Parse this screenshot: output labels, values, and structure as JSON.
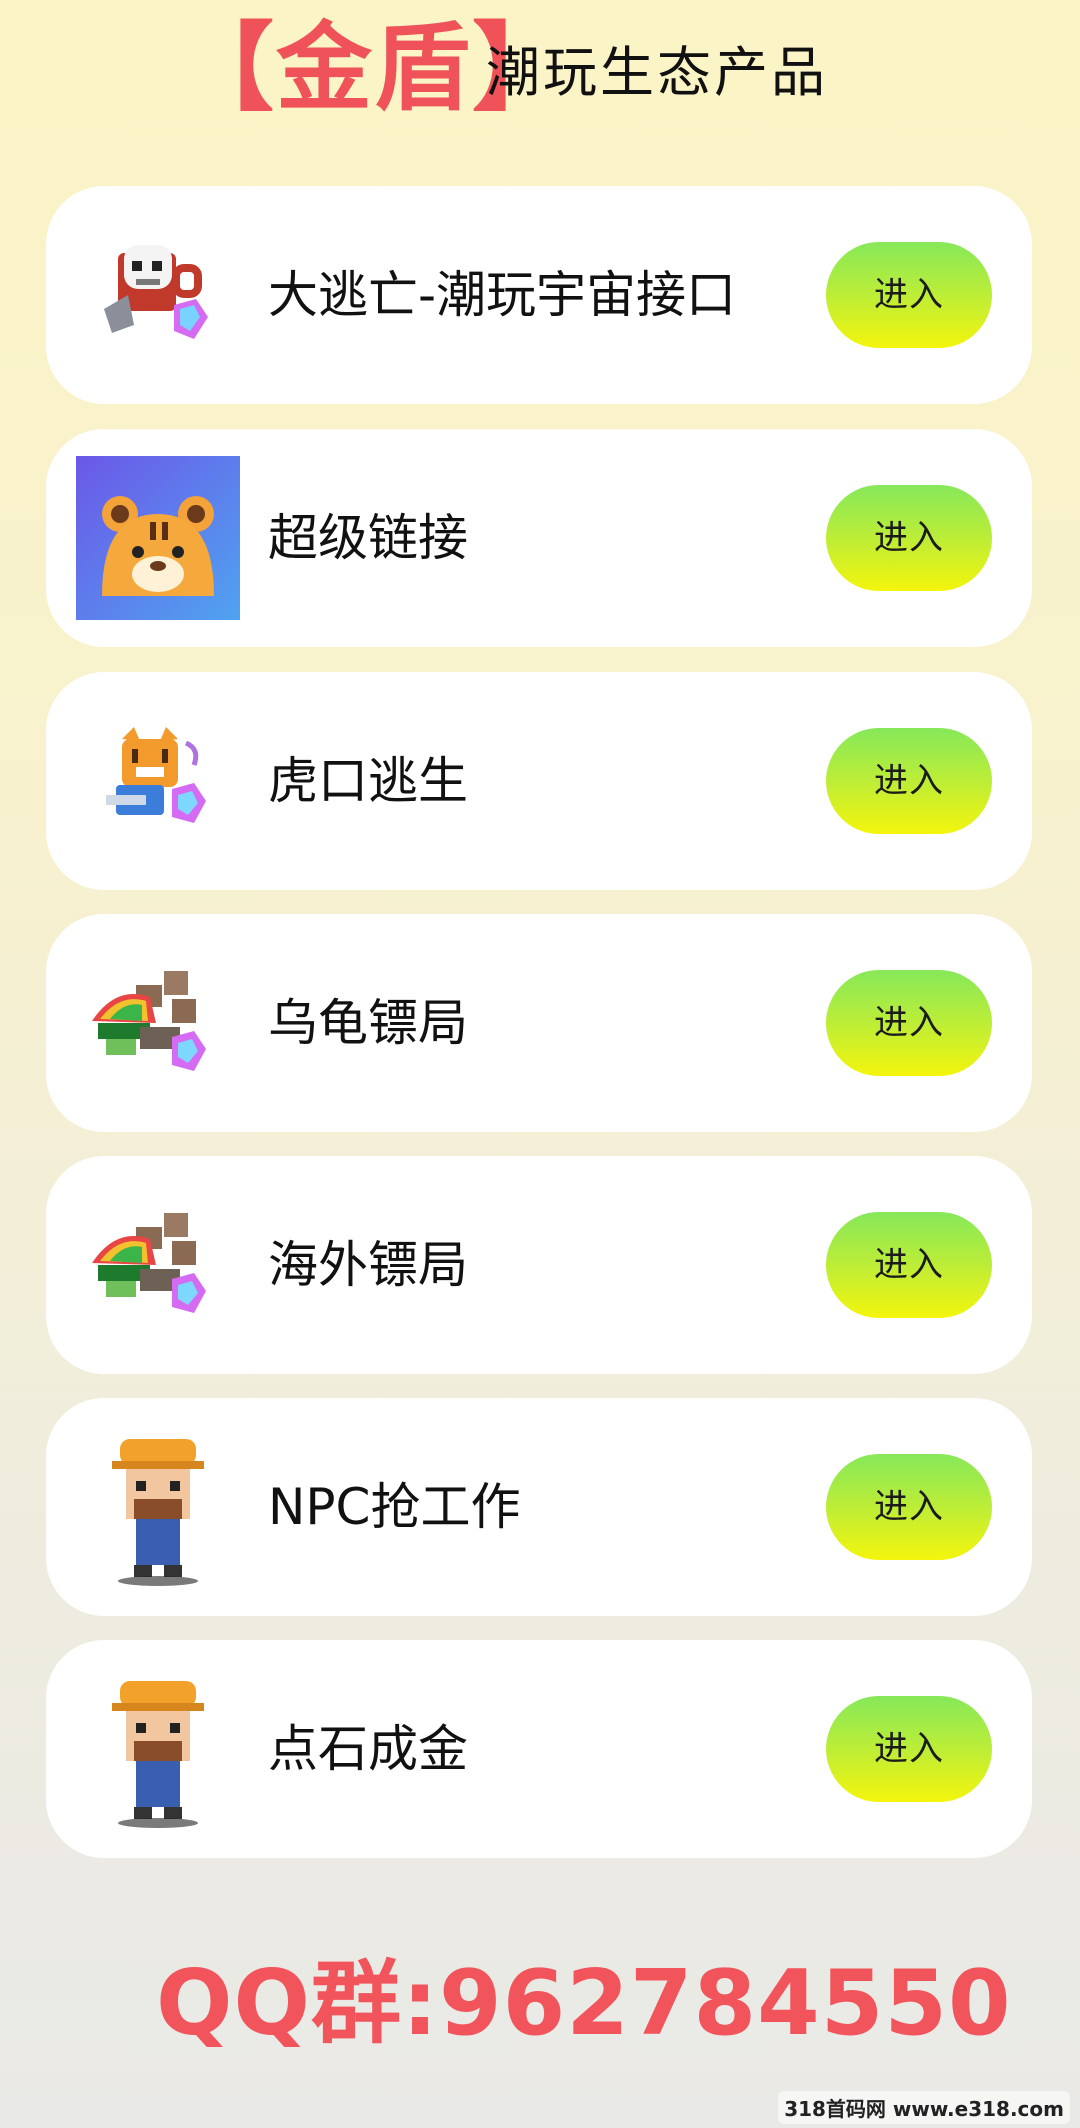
{
  "header": {
    "brand": "【金盾】",
    "subtitle": "潮玩生态产品"
  },
  "products": [
    {
      "name": "大逃亡-潮玩宇宙接口",
      "button": "进入",
      "icon": "skull-mug-crystal-icon"
    },
    {
      "name": "超级链接",
      "button": "进入",
      "icon": "tiger-avatar-icon"
    },
    {
      "name": "虎口逃生",
      "button": "进入",
      "icon": "tiger-crystal-icon"
    },
    {
      "name": "乌龟镖局",
      "button": "进入",
      "icon": "turtle-cargo-icon"
    },
    {
      "name": "海外镖局",
      "button": "进入",
      "icon": "turtle-cargo-icon"
    },
    {
      "name": "NPC抢工作",
      "button": "进入",
      "icon": "worker-character-icon"
    },
    {
      "name": "点石成金",
      "button": "进入",
      "icon": "worker-character-icon"
    }
  ],
  "footer": {
    "qq": "QQ群:962784550",
    "watermark": "318首码网 www.e318.com"
  },
  "colors": {
    "brand": "#f0525a",
    "button_top": "#86e85a",
    "button_bottom": "#f4f50c",
    "card": "#ffffff"
  }
}
